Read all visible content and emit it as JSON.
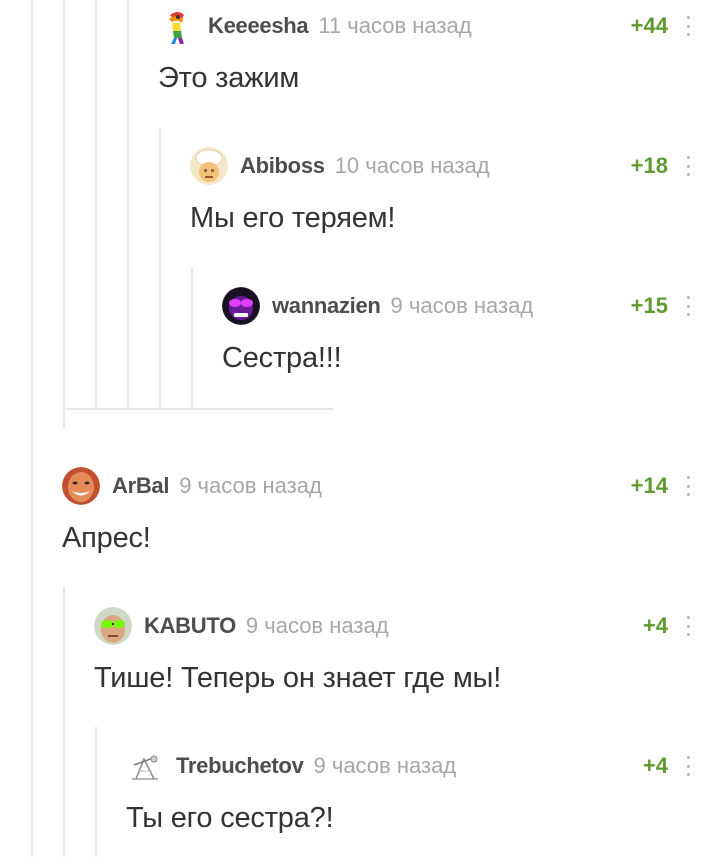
{
  "comments": [
    {
      "author": "Keeeesha",
      "time": "11 часов назад",
      "rating": "+44",
      "text": "Это зажим",
      "avatar": "rainbow-figure-icon"
    },
    {
      "author": "Abiboss",
      "time": "10 часов назад",
      "rating": "+18",
      "text": "Мы его теряем!",
      "avatar": "chef-avatar-icon"
    },
    {
      "author": "wannazien",
      "time": "9 часов назад",
      "rating": "+15",
      "text": "Сестра!!!",
      "avatar": "purple-face-avatar-icon"
    },
    {
      "author": "ArBal",
      "time": "9 часов назад",
      "rating": "+14",
      "text": "Апрес!",
      "avatar": "smiling-man-avatar-icon"
    },
    {
      "author": "KABUTO",
      "time": "9 часов назад",
      "rating": "+4",
      "text": "Тише! Теперь он знает где мы!",
      "avatar": "green-glasses-avatar-icon"
    },
    {
      "author": "Trebuchetov",
      "time": "9 часов назад",
      "rating": "+4",
      "text": "Ты его сестра?!",
      "avatar": "sketch-trebuchet-avatar-icon"
    }
  ],
  "colors": {
    "rating_positive": "#5f9a30",
    "author": "#4d4d4d",
    "time": "#a6a6a6",
    "branch_line": "#e6e6e6"
  }
}
